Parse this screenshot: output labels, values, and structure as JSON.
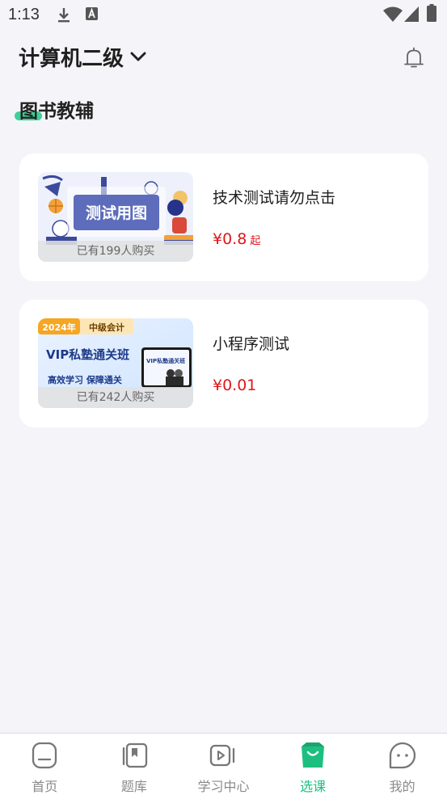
{
  "status_bar": {
    "time": "1:13"
  },
  "header": {
    "subject": "计算机二级"
  },
  "section": {
    "title": "图书教辅"
  },
  "products": [
    {
      "thumbnail_text": "测试用图",
      "buyers": "已有199人购买",
      "title": "技术测试请勿点击",
      "price": "¥0.8",
      "price_suffix": "起"
    },
    {
      "thumbnail_tag_year": "2024年",
      "thumbnail_tag_name": "中级会计",
      "thumbnail_headline": "VIP私塾通关班",
      "thumbnail_subline": "高效学习 保障通关",
      "thumbnail_book_text": "VIP私塾通关班",
      "buyers": "已有242人购买",
      "title": "小程序测试",
      "price": "¥0.01"
    }
  ],
  "nav": {
    "items": [
      {
        "label": "首页",
        "icon": "home-icon"
      },
      {
        "label": "题库",
        "icon": "question-bank-icon"
      },
      {
        "label": "学习中心",
        "icon": "video-play-icon"
      },
      {
        "label": "选课",
        "icon": "shopping-bag-icon"
      },
      {
        "label": "我的",
        "icon": "profile-face-icon"
      }
    ],
    "active_index": 3
  },
  "colors": {
    "accent": "#1dbf80",
    "price": "#e0161b",
    "background": "#f5f5f9"
  }
}
